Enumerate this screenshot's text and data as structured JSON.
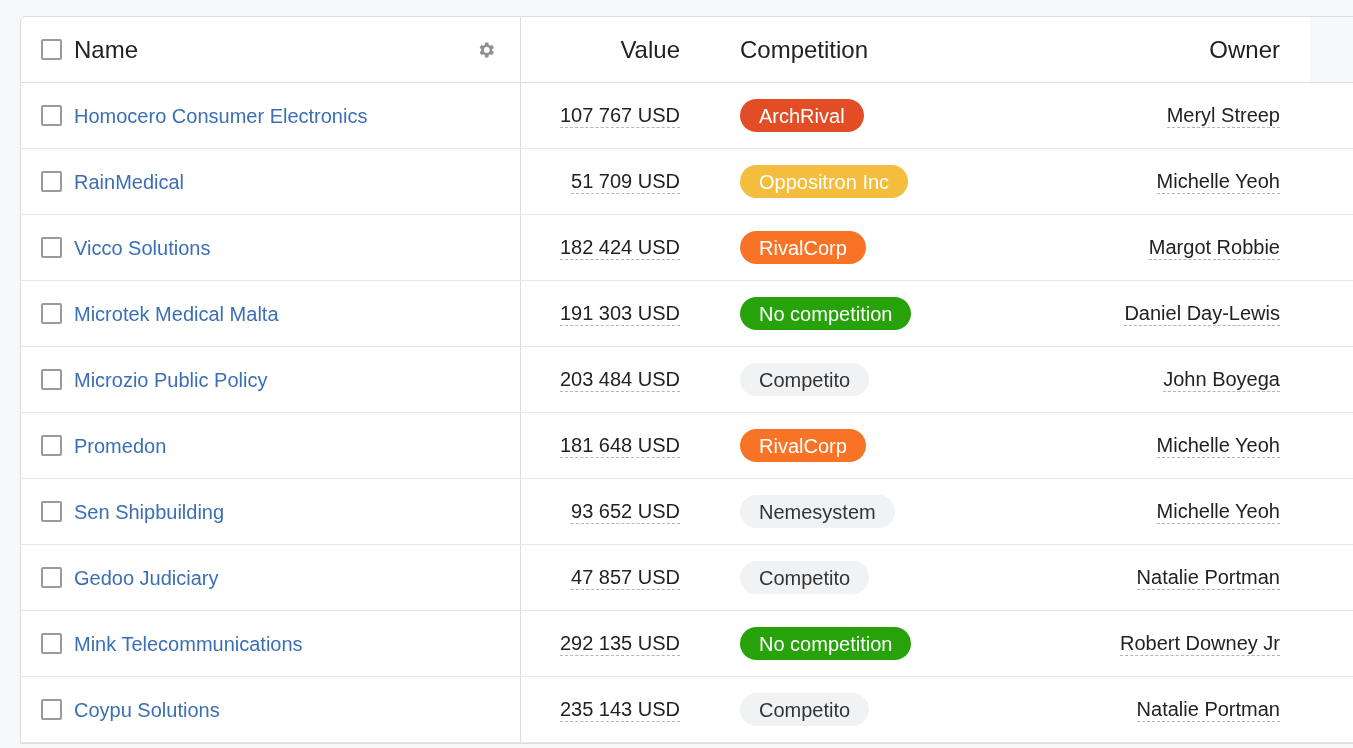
{
  "table": {
    "header_checked": false,
    "columns": [
      "Name",
      "Value",
      "Competition",
      "Owner"
    ],
    "rows": [
      {
        "checked": false,
        "name": "Homocero Consumer Electronics",
        "value": "107 767 USD",
        "competition": "ArchRival",
        "color": "#e34d26",
        "owner": "Meryl Streep"
      },
      {
        "checked": false,
        "name": "RainMedical",
        "value": "51 709 USD",
        "competition": "Oppositron Inc",
        "color": "#f4bd3d",
        "owner": "Michelle Yeoh"
      },
      {
        "checked": false,
        "name": "Vicco Solutions",
        "value": "182 424 USD",
        "competition": "RivalCorp",
        "color": "#f97326",
        "owner": "Margot Robbie"
      },
      {
        "checked": false,
        "name": "Microtek Medical Malta",
        "value": "191 303 USD",
        "competition": "No competition",
        "color": "#27a20a",
        "owner": "Daniel Day-Lewis"
      },
      {
        "checked": false,
        "name": "Microzio Public Policy",
        "value": "203 484 USD",
        "competition": "Competito",
        "color": "#f1f2f4",
        "owner": "John Boyega"
      },
      {
        "checked": false,
        "name": "Promedon",
        "value": "181 648 USD",
        "competition": "RivalCorp",
        "color": "#f97326",
        "owner": "Michelle Yeoh"
      },
      {
        "checked": false,
        "name": "Sen Shipbuilding",
        "value": "93 652 USD",
        "competition": "Nemesystem",
        "color": "#f1f2f4",
        "owner": "Michelle Yeoh"
      },
      {
        "checked": false,
        "name": "Gedoo Judiciary",
        "value": "47 857 USD",
        "competition": "Competito",
        "color": "#f1f2f4",
        "owner": "Natalie Portman"
      },
      {
        "checked": false,
        "name": "Mink Telecommunications",
        "value": "292 135 USD",
        "competition": "No competition",
        "color": "#27a20a",
        "owner": "Robert Downey Jr"
      },
      {
        "checked": false,
        "name": "Coypu Solutions",
        "value": "235 143 USD",
        "competition": "Competito",
        "color": "#f1f2f4",
        "owner": "Natalie Portman"
      }
    ]
  }
}
